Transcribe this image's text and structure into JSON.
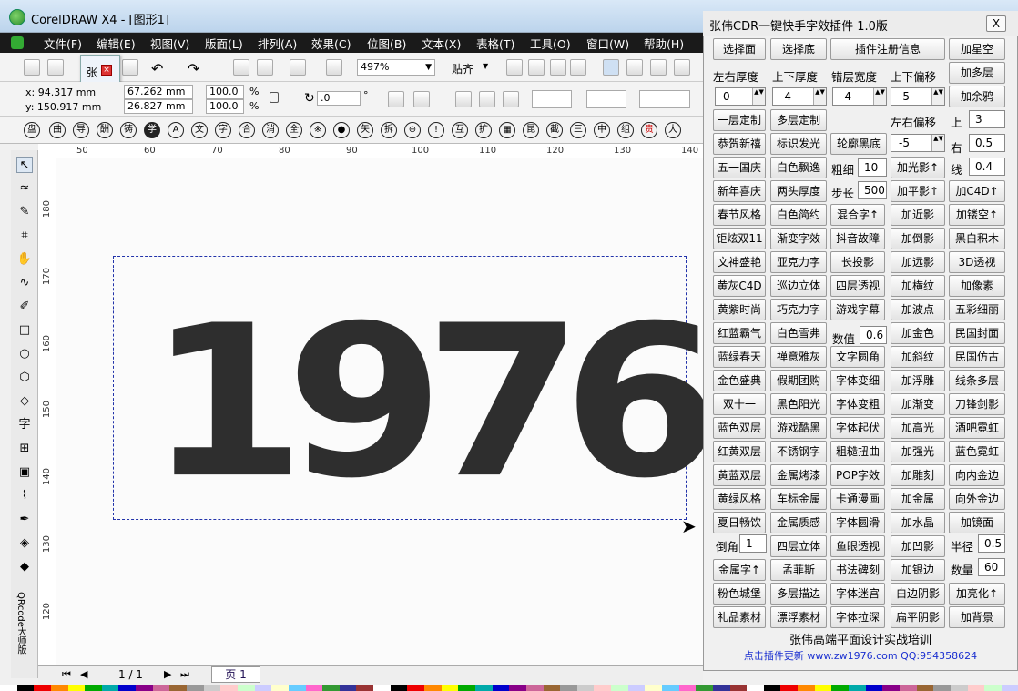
{
  "window": {
    "title": "CorelDRAW X4 - [图形1]"
  },
  "menu": [
    "文件(F)",
    "编辑(E)",
    "视图(V)",
    "版面(L)",
    "排列(A)",
    "效果(C)",
    "位图(B)",
    "文本(X)",
    "表格(T)",
    "工具(O)",
    "窗口(W)",
    "帮助(H)"
  ],
  "toolbar": {
    "zoom": "497%",
    "snap_label": "贴齐"
  },
  "props": {
    "x": "x: 94.317 mm",
    "y": "y: 150.917 mm",
    "width": "67.262 mm",
    "height": "26.827 mm",
    "scale_w": "100.0",
    "scale_h": "100.0",
    "pct": "%",
    "rotation": ".0",
    "degree": "°"
  },
  "popup": {
    "label": "张"
  },
  "glyph_bar": [
    "盘",
    "曲",
    "导",
    "酬",
    "铸",
    "学",
    "A",
    "文",
    "字",
    "合",
    "消",
    "全",
    "※",
    "●",
    "矢",
    "拆",
    "⊖",
    "!",
    "互",
    "扩",
    "▦",
    "昆",
    "截",
    "三",
    "中",
    "组",
    "贵",
    "大"
  ],
  "ruler_h": [
    "50",
    "60",
    "70",
    "80",
    "90",
    "100",
    "110",
    "120",
    "130",
    "140"
  ],
  "ruler_v": [
    "180",
    "170",
    "160",
    "150",
    "140",
    "130",
    "120"
  ],
  "toolbox_label": "QRcode大师版",
  "canvas": {
    "text": "1976"
  },
  "status": {
    "page_count": "1 / 1",
    "page_tab": "页 1"
  },
  "plugin": {
    "title": "张伟CDR一键快手字效插件 1.0版",
    "close": "X",
    "row1": [
      "选择面",
      "选择底",
      "插件注册信息",
      "加星空"
    ],
    "labels": {
      "lr_thick": "左右厚度",
      "ud_thick": "上下厚度",
      "err_width": "错层宽度",
      "ud_offset": "上下偏移",
      "lr_offset": "左右偏移",
      "up": "上",
      "right": "右",
      "line": "线",
      "thick": "粗细",
      "step": "步长",
      "value": "数值",
      "corner": "倒角",
      "radius": "半径",
      "count": "数量"
    },
    "values": {
      "lr": "0",
      "ud": "-4",
      "err": "-4",
      "udoff": "-5",
      "lroff": "-5",
      "up": "3",
      "right": "0.5",
      "line": "0.4",
      "thick": "10",
      "step": "500",
      "num": "0.6",
      "corner": "1",
      "radius": "0.5",
      "count": "60"
    },
    "btn_add_multi": "加多层",
    "btn_add_spray": "加余鸦",
    "row_r4": [
      "一层定制",
      "多层定制"
    ],
    "row_r5": [
      "恭贺新禧",
      "标识发光",
      "轮廓黑底"
    ],
    "row_r6": [
      "五一国庆",
      "白色飘逸",
      "加光影↑"
    ],
    "row_r7": [
      "新年喜庆",
      "两头厚度",
      "加平影↑",
      "加C4D↑"
    ],
    "grid": [
      [
        "春节风格",
        "白色简约",
        "混合字↑",
        "加近影",
        "加镂空↑"
      ],
      [
        "钜炫双11",
        "渐变字效",
        "抖音故障",
        "加倒影",
        "黑白积木"
      ],
      [
        "文神盛艳",
        "亚克力字",
        "长投影",
        "加远影",
        "3D透视"
      ],
      [
        "黄灰C4D",
        "巡边立体",
        "四层透视",
        "加横纹",
        "加像素"
      ],
      [
        "黄紫时尚",
        "巧克力字",
        "游戏字幕",
        "加波点",
        "五彩细丽"
      ],
      [
        "红蓝霸气",
        "白色雪弗",
        "",
        "加金色",
        "民国封面"
      ],
      [
        "蓝绿春天",
        "禅意雅灰",
        "文字圆角",
        "加斜纹",
        "民国仿古"
      ],
      [
        "金色盛典",
        "假期团购",
        "字体变细",
        "加浮雕",
        "线条多层"
      ],
      [
        "双十一",
        "黑色阳光",
        "字体变粗",
        "加渐变",
        "刀锋剑影"
      ],
      [
        "蓝色双层",
        "游戏酷黑",
        "字体起伏",
        "加高光",
        "酒吧霓虹"
      ],
      [
        "红黄双层",
        "不锈钢字",
        "粗糙扭曲",
        "加强光",
        "蓝色霓虹"
      ],
      [
        "黄蓝双层",
        "金属烤漆",
        "POP字效",
        "加雕刻",
        "向内金边"
      ],
      [
        "黄绿风格",
        "车标金属",
        "卡通漫画",
        "加金属",
        "向外金边"
      ],
      [
        "夏日畅饮",
        "金属质感",
        "字体圆滑",
        "加水晶",
        "加镜面"
      ],
      [
        "",
        "四层立体",
        "鱼眼透视",
        "加凹影",
        ""
      ],
      [
        "金属字↑",
        "孟菲斯",
        "书法碑刻",
        "加银边",
        ""
      ],
      [
        "粉色城堡",
        "多层描边",
        "字体迷宫",
        "白边阴影",
        "加亮化↑"
      ],
      [
        "礼品素材",
        "漂浮素材",
        "字体拉深",
        "扁平阴影",
        "加背景"
      ]
    ],
    "footer1": "张伟高端平面设计实战培训",
    "footer2": "点击插件更新 www.zw1976.com    QQ:954358624"
  }
}
